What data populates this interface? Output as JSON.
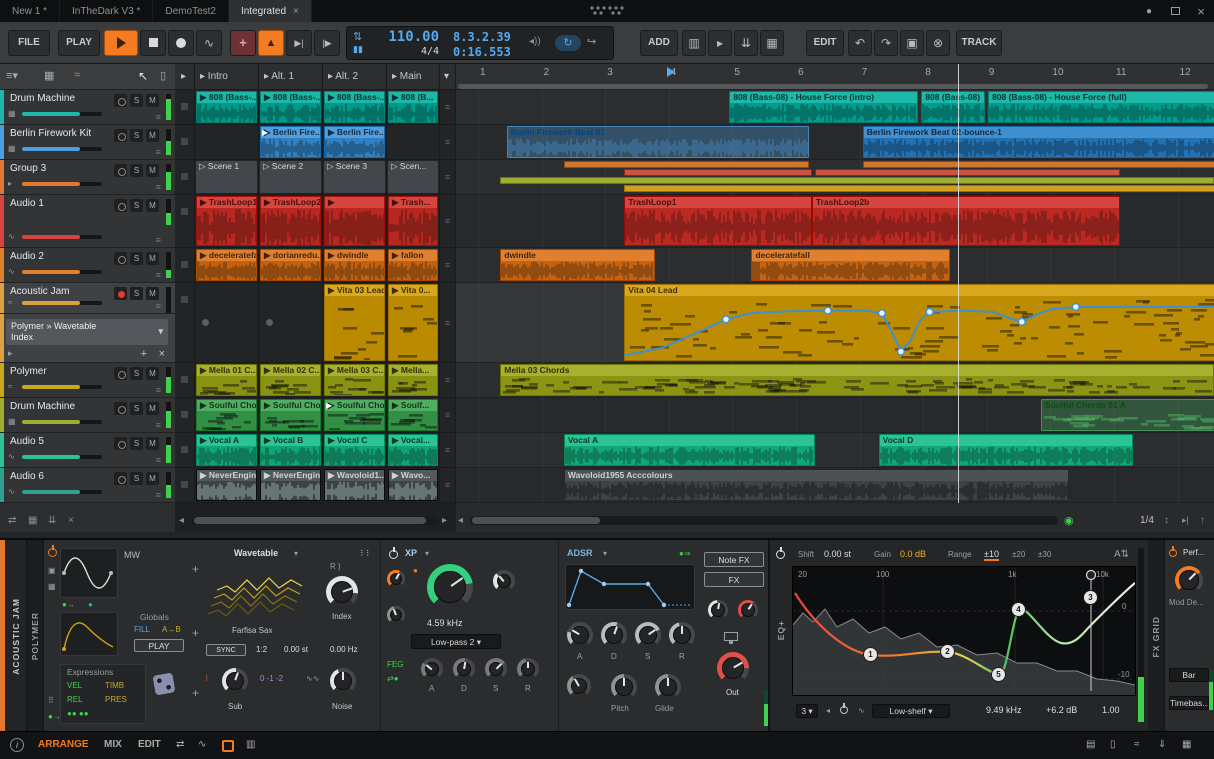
{
  "colors": {
    "accent_orange": "#f47b20",
    "accent_blue": "#54a9f0",
    "meter_green": "#3fd24d",
    "automation_blue": "#3f8fd4",
    "playhead": "#e2e4e6"
  },
  "titlebar": {
    "tabs": [
      {
        "label": "New 1 *",
        "active": false
      },
      {
        "label": "InTheDark V3 *",
        "active": false
      },
      {
        "label": "DemoTest2",
        "active": false
      },
      {
        "label": "Integrated",
        "active": true,
        "close": "×"
      }
    ]
  },
  "transport": {
    "file": "FILE",
    "play": "PLAY",
    "tempo": "110.00",
    "time_signature": "4/4",
    "position": "8.3.2.39",
    "time": "0:16.553",
    "add": "ADD",
    "edit": "EDIT",
    "track": "TRACK"
  },
  "track_list": {
    "solo_label": "S",
    "mute_label": "M",
    "device_selector": {
      "line1": "Polymer » Wavetable",
      "line2": "Index"
    },
    "tracks": [
      {
        "name": "Drum Machine",
        "color": "#1db8a8",
        "type": "drum",
        "meter": 0.8
      },
      {
        "name": "Berlin Firework Kit",
        "color": "#4f9ee0",
        "type": "drum",
        "meter": 0.55
      },
      {
        "name": "Group 3",
        "color": "#e07830",
        "type": "group",
        "meter": 0.7
      },
      {
        "name": "Audio 1",
        "color": "#d8453e",
        "type": "audio",
        "meter": 0.45
      },
      {
        "name": "Audio 2",
        "color": "#e0802e",
        "type": "audio",
        "meter": 0.3
      },
      {
        "name": "Acoustic Jam",
        "color": "#e0a040",
        "type": "instrument",
        "armed": true,
        "selected": true,
        "meter": 0.0
      },
      {
        "name": "Polymer",
        "color": "#c8a81e",
        "type": "instrument",
        "meter": 0.6
      },
      {
        "name": "Drum Machine",
        "color": "#a0ae2e",
        "type": "drum",
        "meter": 0.65
      },
      {
        "name": "Audio 5",
        "color": "#2cc494",
        "type": "audio",
        "meter": 0.7
      },
      {
        "name": "Audio 6",
        "color": "#30a090",
        "type": "audio",
        "meter": 0.5
      }
    ]
  },
  "launcher": {
    "columns": [
      "Intro",
      "Alt. 1",
      "Alt. 2",
      "Main"
    ],
    "rows": [
      {
        "track": 0,
        "kind": "audio",
        "clips": [
          {
            "label": "808 (Bass-..."
          },
          {
            "label": "808 (Bass-..."
          },
          {
            "label": "808 (Bass-..."
          },
          {
            "label": "808 (B..."
          }
        ]
      },
      {
        "track": 1,
        "kind": "audio",
        "clips": [
          null,
          {
            "label": "Berlin Fire...",
            "playing": true
          },
          {
            "label": "Berlin Fire..."
          },
          null
        ]
      },
      {
        "track": 2,
        "kind": "scene",
        "clips": [
          {
            "label": "Scene 1"
          },
          {
            "label": "Scene 2"
          },
          {
            "label": "Scene 3"
          },
          {
            "label": "Scen..."
          }
        ]
      },
      {
        "track": 3,
        "kind": "audio",
        "clips": [
          {
            "label": "TrashLoop1"
          },
          {
            "label": "TrashLoop2b"
          },
          {
            "label": ""
          },
          {
            "label": "Trash..."
          }
        ]
      },
      {
        "track": 4,
        "kind": "audio",
        "clips": [
          {
            "label": "deceleratefall"
          },
          {
            "label": "dorianredu..."
          },
          {
            "label": "dwindle"
          },
          {
            "label": "fallon"
          }
        ]
      },
      {
        "track": 5,
        "kind": "notes",
        "color": "#d8a81e",
        "clips": [
          null,
          null,
          {
            "label": "Vita 03 Lead"
          },
          {
            "label": "Vita 0..."
          }
        ]
      },
      {
        "track": 6,
        "kind": "notes",
        "color": "#a8b030",
        "clips": [
          {
            "label": "Mella 01 C..."
          },
          {
            "label": "Mella 02 C..."
          },
          {
            "label": "Mella 03 C..."
          },
          {
            "label": "Mella..."
          }
        ]
      },
      {
        "track": 7,
        "kind": "notes",
        "color": "#4fae62",
        "clips": [
          {
            "label": "Soulful Cho..."
          },
          {
            "label": "Soulful Cho..."
          },
          {
            "label": "Soulful Cho...",
            "playing": true
          },
          {
            "label": "Soulf..."
          }
        ]
      },
      {
        "track": 8,
        "kind": "audio",
        "clips": [
          {
            "label": "Vocal A"
          },
          {
            "label": "Vocal B"
          },
          {
            "label": "Vocal C"
          },
          {
            "label": "Vocal..."
          }
        ]
      },
      {
        "track": 9,
        "kind": "audio",
        "dark": true,
        "clips": [
          {
            "label": "NeverEngin..."
          },
          {
            "label": "NeverEngin..."
          },
          {
            "label": "Wavoloid1..."
          },
          {
            "label": "Wavo..."
          }
        ]
      }
    ]
  },
  "arranger": {
    "ruler": [
      "1",
      "2",
      "3",
      "4",
      "5",
      "6",
      "7",
      "8",
      "9",
      "10",
      "11",
      "12"
    ],
    "playhead_bar": 8.55,
    "cue_bar": 4.0,
    "clips": [
      {
        "row": 0,
        "label": "808 (Bass-08) - House Force (intro)",
        "start": 4.95,
        "end": 7.92,
        "kind": "audio"
      },
      {
        "row": 0,
        "label": "808 (Bass-08)",
        "start": 7.97,
        "end": 8.97,
        "kind": "audio"
      },
      {
        "row": 0,
        "label": "808 (Bass-08) - House Force (full)",
        "start": 9.02,
        "end": 12.72,
        "kind": "audio"
      },
      {
        "row": 1,
        "label": "Berlin Firework Beat 01",
        "start": 1.45,
        "end": 6.2,
        "kind": "audio",
        "variant": "pale"
      },
      {
        "row": 1,
        "label": "Berlin Firework Beat 02-bounce-1",
        "start": 7.05,
        "end": 12.72,
        "kind": "audio",
        "variant": "dim"
      },
      {
        "row": 3,
        "label": "TrashLoop1",
        "start": 3.3,
        "end": 6.25,
        "kind": "audio"
      },
      {
        "row": 3,
        "label": "TrashLoop2b",
        "start": 6.25,
        "end": 11.1,
        "kind": "audio"
      },
      {
        "row": 4,
        "label": "dwindle",
        "start": 1.35,
        "end": 3.78,
        "kind": "audio"
      },
      {
        "row": 4,
        "label": "deceleratefall",
        "start": 5.3,
        "end": 8.42,
        "kind": "audio"
      },
      {
        "row": 5,
        "label": "Vita 04 Lead",
        "start": 3.3,
        "end": 12.72,
        "kind": "notes"
      },
      {
        "row": 6,
        "label": "Mella 03 Chords",
        "start": 1.35,
        "end": 12.58,
        "kind": "notes"
      },
      {
        "row": 7,
        "label": "Soulful Chords 01 A",
        "start": 9.85,
        "end": 12.72,
        "kind": "notes",
        "variant": "pale"
      },
      {
        "row": 8,
        "label": "Vocal A",
        "start": 2.35,
        "end": 6.3,
        "kind": "audio"
      },
      {
        "row": 8,
        "label": "Vocal D",
        "start": 7.3,
        "end": 11.3,
        "kind": "audio"
      },
      {
        "row": 9,
        "label": "Wavoloid1955 Acccolours",
        "start": 2.35,
        "end": 10.3,
        "kind": "audio",
        "variant": "darkclip"
      }
    ],
    "group_lanes": [
      {
        "color": "#d0742e",
        "segments": [
          [
            2.35,
            6.2
          ],
          [
            7.05,
            12.72
          ]
        ]
      },
      {
        "color": "#cc5244",
        "segments": [
          [
            3.3,
            6.25
          ],
          [
            6.3,
            11.1
          ]
        ]
      },
      {
        "color": "#9fae2e",
        "segments": [
          [
            1.35,
            12.58
          ]
        ]
      },
      {
        "color": "#d4a01c",
        "segments": [
          [
            3.3,
            12.72
          ]
        ]
      }
    ],
    "automation": {
      "color": "#3f8fd4",
      "points": [
        [
          3.3,
          0.06
        ],
        [
          3.9,
          0.18
        ],
        [
          4.5,
          0.45
        ],
        [
          4.9,
          0.64
        ],
        [
          5.3,
          0.74
        ],
        [
          5.9,
          0.77
        ],
        [
          6.5,
          0.78
        ],
        [
          7.1,
          0.78
        ],
        [
          7.35,
          0.74
        ],
        [
          7.5,
          0.45
        ],
        [
          7.65,
          0.12
        ],
        [
          7.8,
          0.3
        ],
        [
          7.95,
          0.62
        ],
        [
          8.1,
          0.76
        ],
        [
          8.6,
          0.78
        ],
        [
          9.1,
          0.76
        ],
        [
          9.35,
          0.66
        ],
        [
          9.55,
          0.6
        ],
        [
          9.75,
          0.7
        ],
        [
          10.0,
          0.8
        ],
        [
          10.4,
          0.84
        ],
        [
          11.5,
          0.84
        ],
        [
          12.72,
          0.84
        ]
      ],
      "nodes": [
        [
          4.9,
          0.64
        ],
        [
          6.5,
          0.78
        ],
        [
          7.35,
          0.74
        ],
        [
          7.65,
          0.12
        ],
        [
          8.1,
          0.76
        ],
        [
          9.55,
          0.6
        ],
        [
          10.4,
          0.84
        ]
      ]
    }
  },
  "footer": {
    "grid_value": "1/4"
  },
  "device_panel": {
    "track_label": "ACOUSTIC JAM",
    "device_tab": "POLYMER",
    "polymer": {
      "osc_mod_label": "MW",
      "globals": {
        "title": "Globals",
        "fill": "FILL",
        "ab": "A→B",
        "play": "PLAY"
      },
      "expressions": {
        "title": "Expressions",
        "vel": "VEL",
        "timb": "TIMB",
        "rel": "REL",
        "pres": "PRES"
      },
      "wavetable": {
        "title": "Wavetable",
        "preset": "Farfisa Sax",
        "index": "Index",
        "sync": "SYNC",
        "ratio": "1:2",
        "detune": "0.00 st",
        "freq": "0.00 Hz",
        "sub": "Sub",
        "octaves": "0  -1  -2",
        "noise": "Noise"
      },
      "filter": {
        "title": "XP",
        "cutoff": "4.59 kHz",
        "mode": "Low-pass 2",
        "feg": "FEG",
        "a": "A",
        "d": "D",
        "s": "S",
        "r": "R"
      },
      "envelope": {
        "title": "ADSR",
        "a": "A",
        "d": "D",
        "s": "S",
        "r": "R"
      },
      "tabs": {
        "note_fx": "Note FX",
        "fx": "FX"
      },
      "outputs": {
        "pitch": "Pitch",
        "glide": "Glide",
        "out": "Out"
      }
    },
    "eq": {
      "title": "EQ+",
      "shift_label": "Shift",
      "shift_value": "0.00 st",
      "gain_label": "Gain",
      "gain_value": "0.0 dB",
      "range_label": "Range",
      "range_options": [
        "±10",
        "±20",
        "±30"
      ],
      "freq_labels": [
        "20",
        "100",
        "1k",
        "10k"
      ],
      "db_labels": [
        "0",
        "-10"
      ],
      "nodes": [
        "1",
        "2",
        "5",
        "4",
        "3"
      ],
      "band_index": "3",
      "band_type": "Low-shelf",
      "band_freq": "9.49 kHz",
      "band_gain": "+6.2 dB",
      "band_q": "1.00"
    },
    "fx_grid": {
      "tab": "FX GRID",
      "header": "Perf...",
      "knob_label": "Mod De...",
      "bar": "Bar",
      "timebase": "Timebas..."
    }
  },
  "statusbar": {
    "info": "i",
    "arrange": "ARRANGE",
    "mix": "MIX",
    "edit": "EDIT"
  }
}
